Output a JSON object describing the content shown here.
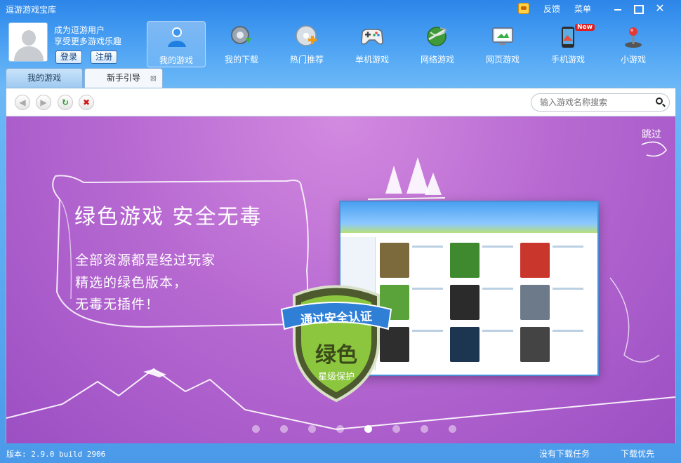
{
  "window": {
    "title": "逗游游戏宝库",
    "feedback": "反馈",
    "menu": "菜单"
  },
  "user": {
    "name_line": "成为逗游用户",
    "tagline": "享受更多游戏乐趣",
    "login": "登录",
    "register": "注册"
  },
  "nav": [
    {
      "label": "我的游戏",
      "icon": "my-games-icon",
      "active": true
    },
    {
      "label": "我的下载",
      "icon": "download-icon"
    },
    {
      "label": "热门推荐",
      "icon": "hot-recommend-icon"
    },
    {
      "label": "单机游戏",
      "icon": "gamepad-icon"
    },
    {
      "label": "网络游戏",
      "icon": "online-game-icon"
    },
    {
      "label": "网页游戏",
      "icon": "web-game-icon"
    },
    {
      "label": "手机游戏",
      "icon": "mobile-game-icon",
      "badge": "New"
    },
    {
      "label": "小游戏",
      "icon": "joystick-icon"
    }
  ],
  "tabs": [
    {
      "label": "我的游戏"
    },
    {
      "label": "新手引导",
      "active": true
    }
  ],
  "search": {
    "placeholder": "输入游戏名称搜索"
  },
  "banner": {
    "skip": "跳过",
    "headline": "绿色游戏 安全无毒",
    "lines": [
      "全部资源都是经过玩家",
      "精选的绿色版本，",
      "无毒无插件！"
    ],
    "shield_ribbon": "通过安全认证",
    "shield_big": "绿色",
    "shield_small": "星级保护",
    "slide_count": 8,
    "active_slide": 5
  },
  "status": {
    "version": "版本: 2.9.0 build 2906",
    "tasks": "没有下载任务",
    "priority": "下载优先"
  },
  "colors": {
    "accent": "#2d86e8",
    "banner": "#b86ad2",
    "shield": "#8cc63f"
  }
}
